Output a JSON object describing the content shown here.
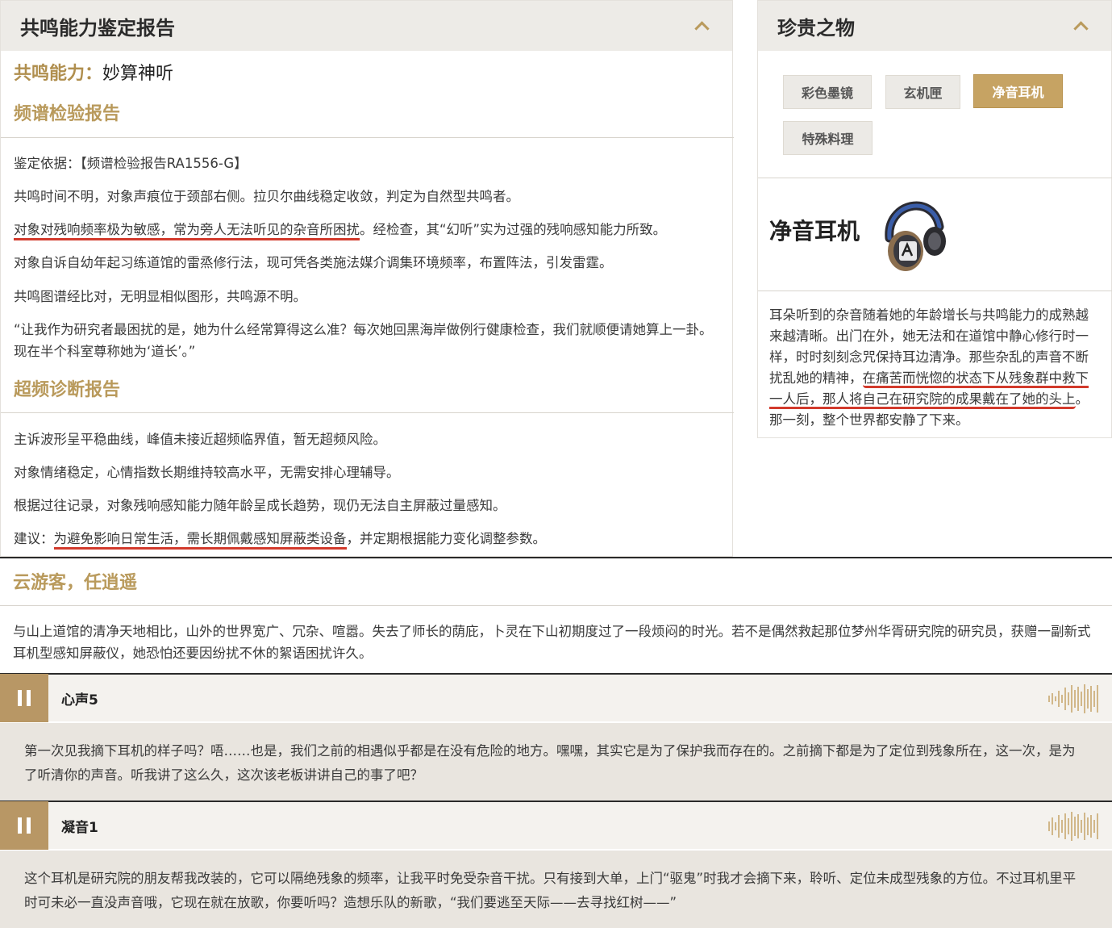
{
  "report": {
    "title": "共鸣能力鉴定报告",
    "ability_key": "共鸣能力：",
    "ability_value": "妙算神听",
    "spectrum_title": "频谱检验报告",
    "spectrum_paras": {
      "p1": "鉴定依据：【频谱检验报告RA1556-G】",
      "p2": "共鸣时间不明，对象声痕位于颈部右侧。拉贝尔曲线稳定收敛，判定为自然型共鸣者。",
      "p3_underlined": "对象对残响频率极为敏感，常为旁人无法听见的杂音所困扰",
      "p3_rest": "。经检查，其“幻听”实为过强的残响感知能力所致。",
      "p4": "对象自诉自幼年起习练道馆的雷烝修行法，现可凭各类施法媒介调集环境频率，布置阵法，引发雷霆。",
      "p5": "共鸣图谱经比对，无明显相似图形，共鸣源不明。",
      "p6": "“让我作为研究者最困扰的是，她为什么经常算得这么准？每次她回黑海岸做例行健康检查，我们就顺便请她算上一卦。现在半个科室尊称她为‘道长’。”"
    },
    "overfreq_title": "超频诊断报告",
    "overfreq_paras": {
      "p1": "主诉波形呈平稳曲线，峰值未接近超频临界值，暂无超频风险。",
      "p2": "对象情绪稳定，心情指数长期维持较高水平，无需安排心理辅导。",
      "p3": "根据过往记录，对象残响感知能力随年龄呈成长趋势，现仍无法自主屏蔽过量感知。",
      "p4_pre": "建议：",
      "p4_underlined": "为避免影响日常生活，需长期佩戴感知屏蔽类设备",
      "p4_rest": "，并定期根据能力变化调整参数。"
    }
  },
  "precious": {
    "title": "珍贵之物",
    "chips": [
      "彩色墨镜",
      "玄机匣",
      "净音耳机",
      "特殊料理"
    ],
    "active_chip": "净音耳机",
    "item_name": "净音耳机",
    "item_icon": "headphones-icon",
    "desc_pre": "耳朵听到的杂音随着她的年龄增长与共鸣能力的成熟越来越清晰。出门在外，她无法和在道馆中静心修行时一样，时时刻刻念咒保持耳边清净。那些杂乱的声音不断扰乱她的精神，",
    "desc_underlined": "在痛苦而恍惚的状态下从残象群中救下一人后，那人将自己在研究院的成果戴在了她的头上",
    "desc_rest": "。那一刻，整个世界都安静了下来。"
  },
  "story": {
    "title": "云游客，任逍遥",
    "body": "与山上道馆的清净天地相比，山外的世界宽广、冗杂、喧嚣。失去了师长的荫庇，卜灵在下山初期度过了一段烦闷的时光。若不是偶然救起那位梦州华胥研究院的研究员，获赠一副新式耳机型感知屏蔽仪，她恐怕还要因纷扰不休的絮语困扰许久。"
  },
  "voices": [
    {
      "title": "心声5",
      "text": "第一次见我摘下耳机的样子吗？唔……也是，我们之前的相遇似乎都是在没有危险的地方。嘿嘿，其实它是为了保护我而存在的。之前摘下都是为了定位到残象所在，这一次，是为了听清你的声音。听我讲了这么久，这次该老板讲讲自己的事了吧？"
    },
    {
      "title": "凝音1",
      "text": "这个耳机是研究院的朋友帮我改装的，它可以隔绝残象的频率，让我平时免受杂音干扰。只有接到大单，上门“驱鬼”时我才会摘下来，聆听、定位未成型残象的方位。不过耳机里平时可未必一直没声音哦，它现在就在放歌，你要听吗？造想乐队的新歌，“我们要逃至天际——去寻找红树——”"
    }
  ],
  "colors": {
    "accent_gold": "#b99a5c",
    "active_chip": "#c6a363",
    "underline_red": "#d23a2c",
    "header_bg": "#edebe7",
    "voice_text_bg": "#e9e5df"
  }
}
